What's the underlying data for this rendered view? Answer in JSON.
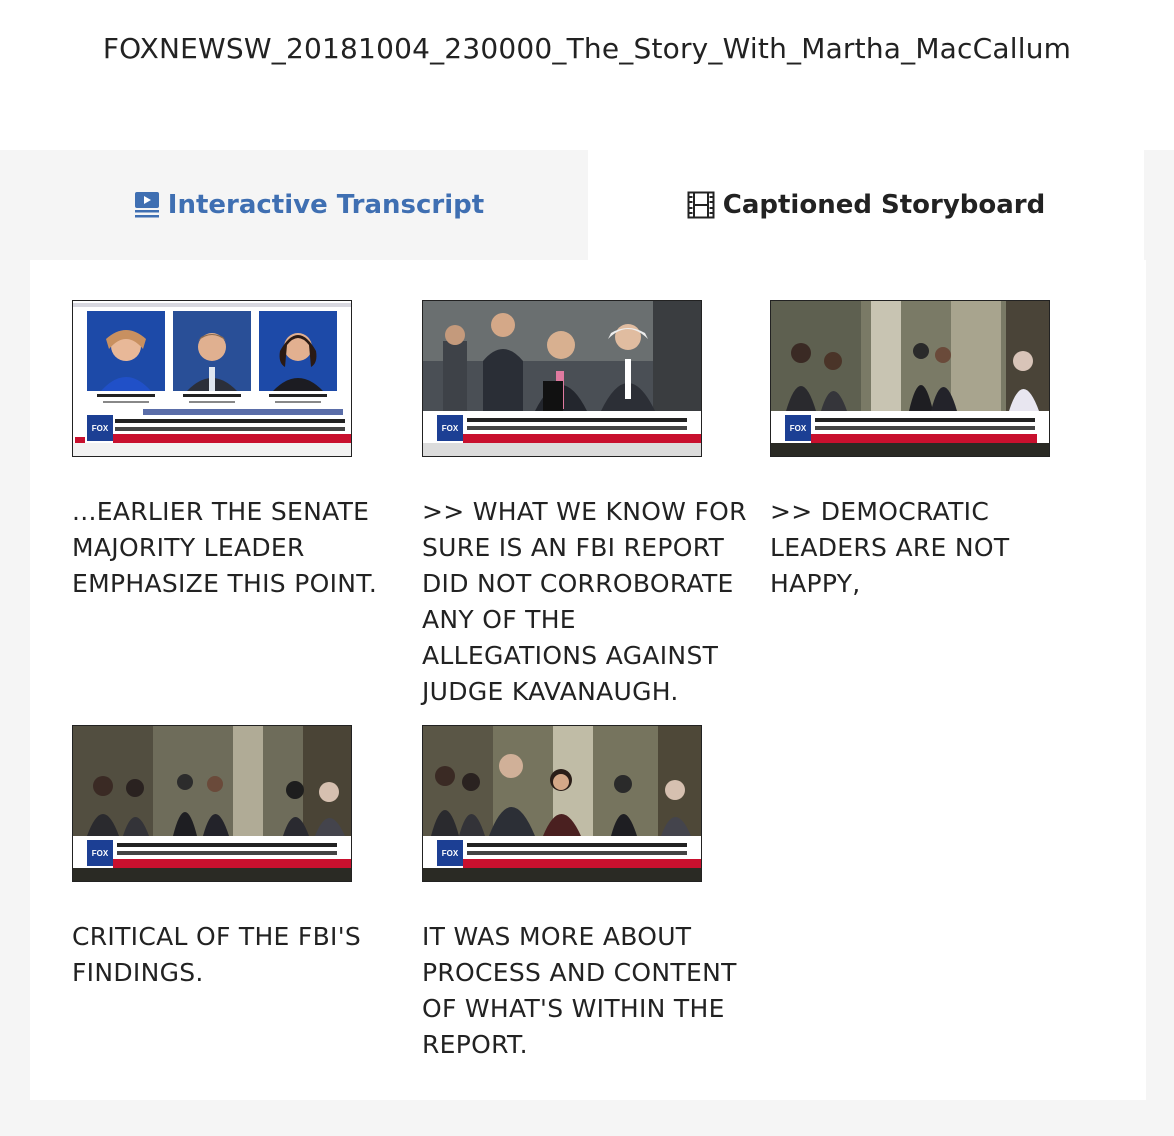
{
  "page": {
    "title": "FOXNEWSW_20181004_230000_The_Story_With_Martha_MacCallum"
  },
  "tabs": [
    {
      "label": "Interactive Transcript",
      "icon": "video-transcript-icon",
      "color": "#3f6fb2"
    },
    {
      "label": "Captioned Storyboard",
      "icon": "film-strip-icon",
      "color": "#222222"
    }
  ],
  "storyboard": {
    "items": [
      {
        "caption": "...EARLIER THE SENATE MAJORITY LEADER EMPHASIZE THIS POINT.",
        "thumbnail": "three-senators-headshots-thumbnail"
      },
      {
        "caption": ">> WHAT WE KNOW FOR SURE IS AN FBI REPORT DID NOT CORROBORATE ANY OF THE ALLEGATIONS AGAINST JUDGE KAVANAUGH.",
        "thumbnail": "senate-majority-leader-podium-thumbnail"
      },
      {
        "caption": ">> DEMOCRATIC LEADERS ARE NOT HAPPY,",
        "thumbnail": "capitol-hallway-press-thumbnail"
      },
      {
        "caption": "CRITICAL OF THE FBI'S FINDINGS.",
        "thumbnail": "capitol-hallway-reporters-thumbnail"
      },
      {
        "caption": "IT WAS MORE ABOUT PROCESS AND CONTENT OF WHAT'S WITHIN THE REPORT.",
        "thumbnail": "democratic-leaders-hallway-thumbnail"
      }
    ]
  },
  "colors": {
    "accent": "#3f6fb2",
    "panel_bg": "#f5f5f5",
    "fox_banner_red": "#c8102e",
    "fox_logo_blue": "#1c3f94"
  }
}
